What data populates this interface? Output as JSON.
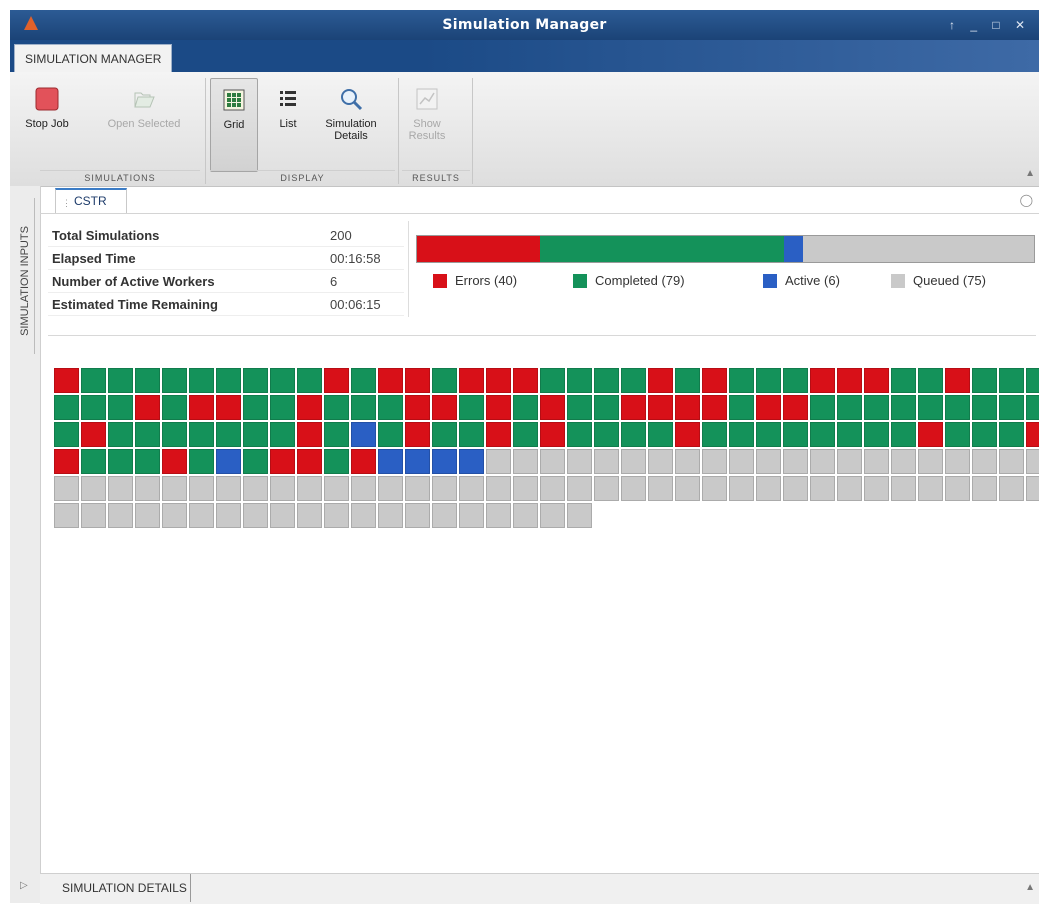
{
  "window": {
    "title": "Simulation Manager",
    "controls": "↑ _ □ ✕"
  },
  "ribbon_tab": "SIMULATION MANAGER",
  "toolbar": {
    "stop_job": "Stop Job",
    "open_selected": "Open Selected",
    "grid": "Grid",
    "list": "List",
    "simulation_details_1": "Simulation",
    "simulation_details_2": "Details",
    "show_results_1": "Show",
    "show_results_2": "Results"
  },
  "sections": {
    "simulations": "SIMULATIONS",
    "display": "DISPLAY",
    "results": "RESULTS"
  },
  "side_tab": "SIMULATION INPUTS",
  "doc_tab": "CSTR",
  "stats": [
    {
      "label": "Total Simulations",
      "value": "200"
    },
    {
      "label": "Elapsed Time",
      "value": "00:16:58"
    },
    {
      "label": "Number of Active Workers",
      "value": "6"
    },
    {
      "label": "Estimated Time Remaining",
      "value": "00:06:15"
    }
  ],
  "progress": {
    "errors": 40,
    "completed": 79,
    "active": 6,
    "queued": 75,
    "total": 200
  },
  "legend": {
    "errors": "Errors (40)",
    "completed": "Completed (79)",
    "active": "Active (6)",
    "queued": "Queued (75)"
  },
  "colors": {
    "error": "#d81018",
    "completed": "#14925a",
    "active": "#2a5fc4",
    "queued": "#c9c9c9"
  },
  "grid_rows": [
    "ECCCCCCCCCECEECEEECCCCECECCCEEECCECCC",
    "CCCECEECCECCCEECECECCEEEECEECCCCCCCCC",
    "CECCCCCCCECACECCECECCCCECCCCCCCCECCCE",
    "ECCCECACEECEAAAAQQQQQQQQQQQQQQQQQQQQQ",
    "QQQQQQQQQQQQQQQQQQQQQQQQQQQQQQQQQQQQQ",
    "QQQQQQQQQQQQQQQQQQQQ"
  ],
  "bottom_tab": "SIMULATION DETAILS"
}
